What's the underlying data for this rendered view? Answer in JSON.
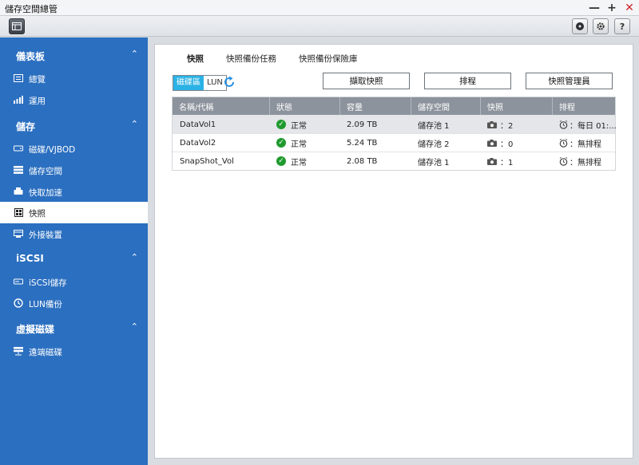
{
  "window": {
    "title": "儲存空間總管"
  },
  "sidebar": {
    "sections": [
      {
        "label": "儀表板",
        "items": [
          {
            "label": "總覽"
          },
          {
            "label": "運用"
          }
        ]
      },
      {
        "label": "儲存",
        "items": [
          {
            "label": "磁碟/VJBOD"
          },
          {
            "label": "儲存空間"
          },
          {
            "label": "快取加速"
          },
          {
            "label": "快照"
          },
          {
            "label": "外接裝置"
          }
        ]
      },
      {
        "label": "iSCSI",
        "items": [
          {
            "label": "iSCSI儲存"
          },
          {
            "label": "LUN備份"
          }
        ]
      },
      {
        "label": "虛擬磁碟",
        "items": [
          {
            "label": "遠端磁碟"
          }
        ]
      }
    ],
    "active_item": "快照"
  },
  "main": {
    "tabs": [
      {
        "label": "快照"
      },
      {
        "label": "快照備份任務"
      },
      {
        "label": "快照備份保險庫"
      }
    ],
    "toggle": {
      "options": [
        {
          "label": "磁碟區"
        },
        {
          "label": "LUN"
        }
      ]
    },
    "buttons": {
      "take_snapshot": "擷取快照",
      "schedule": "排程",
      "snapshot_manager": "快照管理員"
    },
    "table": {
      "headers": [
        "名稱/代稱",
        "狀態",
        "容量",
        "儲存空間",
        "快照",
        "排程"
      ],
      "rows": [
        {
          "name": "DataVol1",
          "status": "正常",
          "capacity": "2.09 TB",
          "pool": "儲存池 1",
          "snapshots": "：2",
          "schedule": "：每日 01:..."
        },
        {
          "name": "DataVol2",
          "status": "正常",
          "capacity": "5.24 TB",
          "pool": "儲存池 2",
          "snapshots": "：0",
          "schedule": "：無排程"
        },
        {
          "name": "SnapShot_Vol",
          "status": "正常",
          "capacity": "2.08 TB",
          "pool": "儲存池 1",
          "snapshots": "：1",
          "schedule": "：無排程"
        }
      ]
    }
  },
  "colors": {
    "sidebar": "#2b6fc0",
    "toggle_active": "#2bb2e5",
    "status_ok": "#1f9a2e",
    "header": "#8c939c"
  }
}
